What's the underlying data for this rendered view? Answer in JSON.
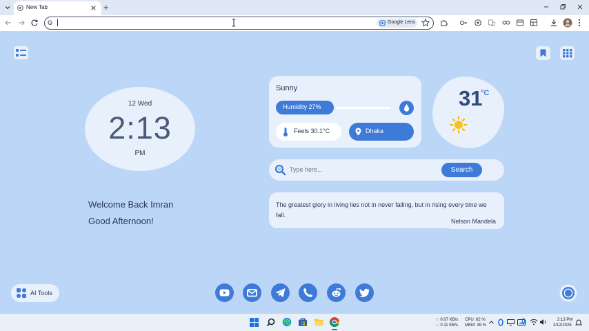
{
  "browser": {
    "tab_title": "New Tab",
    "new_tab_symbol": "+",
    "omnibox_value": "",
    "lens_label": "Google Lens"
  },
  "clock": {
    "date": "12 Wed",
    "time": "2:13",
    "ampm": "PM"
  },
  "welcome": {
    "line1": "Welcome Back Imran",
    "line2": "Good Afternoon!"
  },
  "weather": {
    "condition": "Sunny",
    "humidity_label": "Humidity 27%",
    "humidity_percent": 27,
    "feels_like": "Feels 30.1°C",
    "city": "Dhaka",
    "temperature": "31",
    "unit": "°C"
  },
  "search": {
    "placeholder": "Type here...",
    "button_label": "Search"
  },
  "quote": {
    "text": "The greatest glory in living lies not in never falling, but in rising every time we fall.",
    "author": "Nelson Mandela"
  },
  "ai_tools": {
    "label": "AI Tools"
  },
  "social_links": [
    "youtube-icon",
    "mail-icon",
    "telegram-icon",
    "whatsapp-icon",
    "reddit-icon",
    "twitter-icon"
  ],
  "taskbar": {
    "net_up": "↑: 0.07 KB/s",
    "net_down": "↓: 0.11 KB/s",
    "cpu": "CPU: 62 %",
    "mem": "MEM: 39 %",
    "time": "2:13 PM",
    "date": "2/12/2025"
  },
  "colors": {
    "accent": "#3e7bd8",
    "background": "#bcd6f7",
    "card": "#e8f0fc"
  }
}
